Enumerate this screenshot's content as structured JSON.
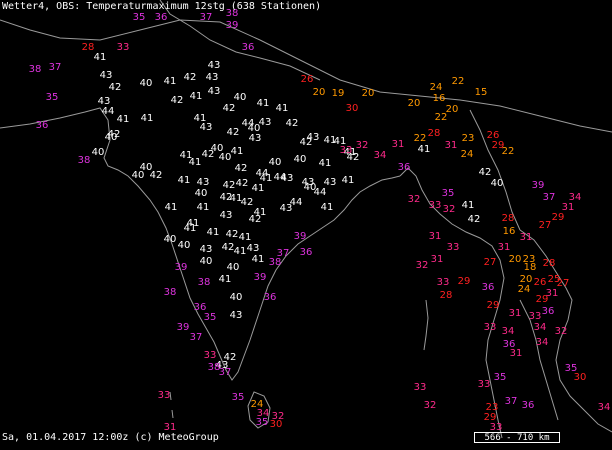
{
  "header": {
    "title": "Wetter4, OBS: Temperaturmaximum 12stg (638 Stationen)"
  },
  "footer": {
    "timestamp": "Sa, 01.04.2017 12:00z (c) MeteoGroup"
  },
  "scale": {
    "label": "566 - 710 km"
  },
  "colors": {
    "background": "#000000",
    "border": "#9a9a9a",
    "hot_white": "#ffffff",
    "magenta": "#dd33dd",
    "pink": "#ff2a8a",
    "red": "#ff2020",
    "orange": "#ff9900"
  },
  "stations": [
    {
      "v": "35",
      "c": "magenta"
    },
    {
      "v": "36",
      "c": "magenta"
    },
    {
      "v": "28",
      "c": "red"
    },
    {
      "v": "33",
      "c": "pink"
    },
    {
      "v": "38",
      "c": "magenta"
    },
    {
      "v": "37",
      "c": "magenta"
    },
    {
      "v": "35",
      "c": "magenta"
    },
    {
      "v": "36",
      "c": "magenta"
    },
    {
      "v": "41",
      "c": "hot_white"
    },
    {
      "v": "43",
      "c": "hot_white"
    },
    {
      "v": "40",
      "c": "hot_white"
    },
    {
      "v": "42",
      "c": "hot_white"
    },
    {
      "v": "43",
      "c": "hot_white"
    },
    {
      "v": "44",
      "c": "hot_white"
    },
    {
      "v": "41",
      "c": "hot_white"
    },
    {
      "v": "42",
      "c": "hot_white"
    },
    {
      "v": "40",
      "c": "hot_white"
    },
    {
      "v": "40",
      "c": "hot_white"
    },
    {
      "v": "38",
      "c": "magenta"
    },
    {
      "v": "41",
      "c": "hot_white"
    },
    {
      "v": "42",
      "c": "hot_white"
    },
    {
      "v": "41",
      "c": "hot_white"
    },
    {
      "v": "43",
      "c": "hot_white"
    },
    {
      "v": "43",
      "c": "hot_white"
    },
    {
      "v": "43",
      "c": "hot_white"
    },
    {
      "v": "41",
      "c": "hot_white"
    },
    {
      "v": "42",
      "c": "hot_white"
    },
    {
      "v": "41",
      "c": "hot_white"
    },
    {
      "v": "43",
      "c": "hot_white"
    },
    {
      "v": "42",
      "c": "hot_white"
    },
    {
      "v": "40",
      "c": "hot_white"
    },
    {
      "v": "41",
      "c": "hot_white"
    },
    {
      "v": "42",
      "c": "hot_white"
    },
    {
      "v": "40",
      "c": "hot_white"
    },
    {
      "v": "43",
      "c": "hot_white"
    },
    {
      "v": "44",
      "c": "hot_white"
    },
    {
      "v": "43",
      "c": "hot_white"
    },
    {
      "v": "41",
      "c": "hot_white"
    },
    {
      "v": "42",
      "c": "hot_white"
    },
    {
      "v": "40",
      "c": "hot_white"
    },
    {
      "v": "41",
      "c": "hot_white"
    },
    {
      "v": "42",
      "c": "hot_white"
    },
    {
      "v": "41",
      "c": "hot_white"
    },
    {
      "v": "40",
      "c": "hot_white"
    },
    {
      "v": "41",
      "c": "hot_white"
    },
    {
      "v": "40",
      "c": "hot_white"
    },
    {
      "v": "42",
      "c": "hot_white"
    },
    {
      "v": "40",
      "c": "hot_white"
    },
    {
      "v": "43",
      "c": "hot_white"
    },
    {
      "v": "41",
      "c": "hot_white"
    },
    {
      "v": "42",
      "c": "hot_white"
    },
    {
      "v": "44",
      "c": "hot_white"
    },
    {
      "v": "42",
      "c": "hot_white"
    },
    {
      "v": "40",
      "c": "hot_white"
    },
    {
      "v": "40",
      "c": "hot_white"
    },
    {
      "v": "42",
      "c": "hot_white"
    },
    {
      "v": "43",
      "c": "hot_white"
    },
    {
      "v": "41",
      "c": "hot_white"
    },
    {
      "v": "41",
      "c": "hot_white"
    },
    {
      "v": "41",
      "c": "hot_white"
    },
    {
      "v": "42",
      "c": "hot_white"
    },
    {
      "v": "41",
      "c": "hot_white"
    },
    {
      "v": "43",
      "c": "hot_white"
    },
    {
      "v": "44",
      "c": "hot_white"
    },
    {
      "v": "41",
      "c": "hot_white"
    },
    {
      "v": "41",
      "c": "hot_white"
    },
    {
      "v": "40",
      "c": "hot_white"
    },
    {
      "v": "44",
      "c": "hot_white"
    },
    {
      "v": "41",
      "c": "hot_white"
    },
    {
      "v": "42",
      "c": "hot_white"
    },
    {
      "v": "43",
      "c": "hot_white"
    },
    {
      "v": "41",
      "c": "hot_white"
    },
    {
      "v": "41",
      "c": "hot_white"
    },
    {
      "v": "43",
      "c": "hot_white"
    },
    {
      "v": "42",
      "c": "hot_white"
    },
    {
      "v": "41",
      "c": "hot_white"
    },
    {
      "v": "40",
      "c": "hot_white"
    },
    {
      "v": "43",
      "c": "hot_white"
    },
    {
      "v": "41",
      "c": "hot_white"
    },
    {
      "v": "40",
      "c": "hot_white"
    },
    {
      "v": "42",
      "c": "hot_white"
    },
    {
      "v": "41",
      "c": "hot_white"
    },
    {
      "v": "41",
      "c": "hot_white"
    },
    {
      "v": "43",
      "c": "hot_white"
    },
    {
      "v": "44",
      "c": "hot_white"
    },
    {
      "v": "41",
      "c": "hot_white"
    },
    {
      "v": "42",
      "c": "hot_white"
    },
    {
      "v": "40",
      "c": "hot_white"
    },
    {
      "v": "43",
      "c": "hot_white"
    },
    {
      "v": "42",
      "c": "hot_white"
    },
    {
      "v": "40",
      "c": "hot_white"
    },
    {
      "v": "41",
      "c": "hot_white"
    },
    {
      "v": "43",
      "c": "hot_white"
    },
    {
      "v": "41",
      "c": "hot_white"
    },
    {
      "v": "42",
      "c": "hot_white"
    },
    {
      "v": "40",
      "c": "hot_white"
    },
    {
      "v": "41",
      "c": "hot_white"
    },
    {
      "v": "42",
      "c": "hot_white"
    },
    {
      "v": "43",
      "c": "hot_white"
    },
    {
      "v": "43",
      "c": "hot_white"
    },
    {
      "v": "41",
      "c": "hot_white"
    },
    {
      "v": "41",
      "c": "hot_white"
    },
    {
      "v": "40",
      "c": "hot_white"
    },
    {
      "v": "36",
      "c": "magenta"
    },
    {
      "v": "39",
      "c": "magenta"
    },
    {
      "v": "38",
      "c": "magenta"
    },
    {
      "v": "37",
      "c": "magenta"
    },
    {
      "v": "39",
      "c": "magenta"
    },
    {
      "v": "36",
      "c": "magenta"
    },
    {
      "v": "38",
      "c": "magenta"
    },
    {
      "v": "35",
      "c": "magenta"
    },
    {
      "v": "39",
      "c": "magenta"
    },
    {
      "v": "37",
      "c": "magenta"
    },
    {
      "v": "36",
      "c": "magenta"
    },
    {
      "v": "38",
      "c": "magenta"
    },
    {
      "v": "39",
      "c": "magenta"
    },
    {
      "v": "37",
      "c": "magenta"
    },
    {
      "v": "39",
      "c": "magenta"
    },
    {
      "v": "38",
      "c": "magenta"
    },
    {
      "v": "36",
      "c": "magenta"
    },
    {
      "v": "26",
      "c": "red"
    },
    {
      "v": "20",
      "c": "orange"
    },
    {
      "v": "19",
      "c": "orange"
    },
    {
      "v": "20",
      "c": "orange"
    },
    {
      "v": "30",
      "c": "red"
    },
    {
      "v": "20",
      "c": "orange"
    },
    {
      "v": "16",
      "c": "orange"
    },
    {
      "v": "15",
      "c": "orange"
    },
    {
      "v": "22",
      "c": "orange"
    },
    {
      "v": "24",
      "c": "orange"
    },
    {
      "v": "20",
      "c": "orange"
    },
    {
      "v": "22",
      "c": "orange"
    },
    {
      "v": "28",
      "c": "red"
    },
    {
      "v": "22",
      "c": "orange"
    },
    {
      "v": "23",
      "c": "orange"
    },
    {
      "v": "22",
      "c": "orange"
    },
    {
      "v": "24",
      "c": "orange"
    },
    {
      "v": "26",
      "c": "red"
    },
    {
      "v": "29",
      "c": "red"
    },
    {
      "v": "31",
      "c": "pink"
    },
    {
      "v": "33",
      "c": "pink"
    },
    {
      "v": "32",
      "c": "pink"
    },
    {
      "v": "34",
      "c": "pink"
    },
    {
      "v": "31",
      "c": "pink"
    },
    {
      "v": "35",
      "c": "magenta"
    },
    {
      "v": "33",
      "c": "pink"
    },
    {
      "v": "32",
      "c": "pink"
    },
    {
      "v": "36",
      "c": "magenta"
    },
    {
      "v": "41",
      "c": "hot_white"
    },
    {
      "v": "42",
      "c": "hot_white"
    },
    {
      "v": "41",
      "c": "hot_white"
    },
    {
      "v": "42",
      "c": "hot_white"
    },
    {
      "v": "40",
      "c": "hot_white"
    },
    {
      "v": "39",
      "c": "magenta"
    },
    {
      "v": "37",
      "c": "magenta"
    },
    {
      "v": "34",
      "c": "pink"
    },
    {
      "v": "31",
      "c": "pink"
    },
    {
      "v": "29",
      "c": "red"
    },
    {
      "v": "27",
      "c": "red"
    },
    {
      "v": "28",
      "c": "red"
    },
    {
      "v": "31",
      "c": "pink"
    },
    {
      "v": "16",
      "c": "orange"
    },
    {
      "v": "20",
      "c": "orange"
    },
    {
      "v": "23",
      "c": "orange"
    },
    {
      "v": "18",
      "c": "orange"
    },
    {
      "v": "20",
      "c": "orange"
    },
    {
      "v": "24",
      "c": "orange"
    },
    {
      "v": "26",
      "c": "red"
    },
    {
      "v": "25",
      "c": "red"
    },
    {
      "v": "27",
      "c": "red"
    },
    {
      "v": "29",
      "c": "red"
    },
    {
      "v": "28",
      "c": "red"
    },
    {
      "v": "31",
      "c": "pink"
    },
    {
      "v": "33",
      "c": "pink"
    },
    {
      "v": "36",
      "c": "magenta"
    },
    {
      "v": "34",
      "c": "pink"
    },
    {
      "v": "32",
      "c": "pink"
    },
    {
      "v": "35",
      "c": "magenta"
    },
    {
      "v": "30",
      "c": "red"
    },
    {
      "v": "33",
      "c": "pink"
    },
    {
      "v": "31",
      "c": "pink"
    },
    {
      "v": "34",
      "c": "pink"
    },
    {
      "v": "36",
      "c": "magenta"
    },
    {
      "v": "29",
      "c": "red"
    },
    {
      "v": "33",
      "c": "pink"
    },
    {
      "v": "31",
      "c": "pink"
    },
    {
      "v": "32",
      "c": "pink"
    },
    {
      "v": "31",
      "c": "pink"
    },
    {
      "v": "27",
      "c": "red"
    },
    {
      "v": "33",
      "c": "pink"
    },
    {
      "v": "32",
      "c": "pink"
    },
    {
      "v": "31",
      "c": "pink"
    },
    {
      "v": "28",
      "c": "red"
    },
    {
      "v": "29",
      "c": "red"
    },
    {
      "v": "31",
      "c": "pink"
    },
    {
      "v": "34",
      "c": "pink"
    },
    {
      "v": "36",
      "c": "magenta"
    },
    {
      "v": "35",
      "c": "magenta"
    },
    {
      "v": "37",
      "c": "magenta"
    },
    {
      "v": "36",
      "c": "magenta"
    },
    {
      "v": "33",
      "c": "pink"
    },
    {
      "v": "38",
      "c": "magenta"
    },
    {
      "v": "37",
      "c": "magenta"
    },
    {
      "v": "35",
      "c": "magenta"
    },
    {
      "v": "24",
      "c": "orange"
    },
    {
      "v": "34",
      "c": "pink"
    },
    {
      "v": "32",
      "c": "pink"
    },
    {
      "v": "30",
      "c": "red"
    },
    {
      "v": "33",
      "c": "pink"
    },
    {
      "v": "31",
      "c": "pink"
    },
    {
      "v": "35",
      "c": "magenta"
    },
    {
      "v": "33",
      "c": "pink"
    },
    {
      "v": "32",
      "c": "pink"
    },
    {
      "v": "33",
      "c": "pink"
    },
    {
      "v": "23",
      "c": "red"
    },
    {
      "v": "29",
      "c": "red"
    },
    {
      "v": "33",
      "c": "pink"
    },
    {
      "v": "34",
      "c": "pink"
    },
    {
      "v": "31",
      "c": "pink"
    },
    {
      "v": "33",
      "c": "pink"
    },
    {
      "v": "30",
      "c": "red"
    },
    {
      "v": "31",
      "c": "pink"
    },
    {
      "v": "34",
      "c": "pink"
    },
    {
      "v": "32",
      "c": "pink"
    },
    {
      "v": "31",
      "c": "pink"
    },
    {
      "v": "32",
      "c": "pink"
    }
  ]
}
